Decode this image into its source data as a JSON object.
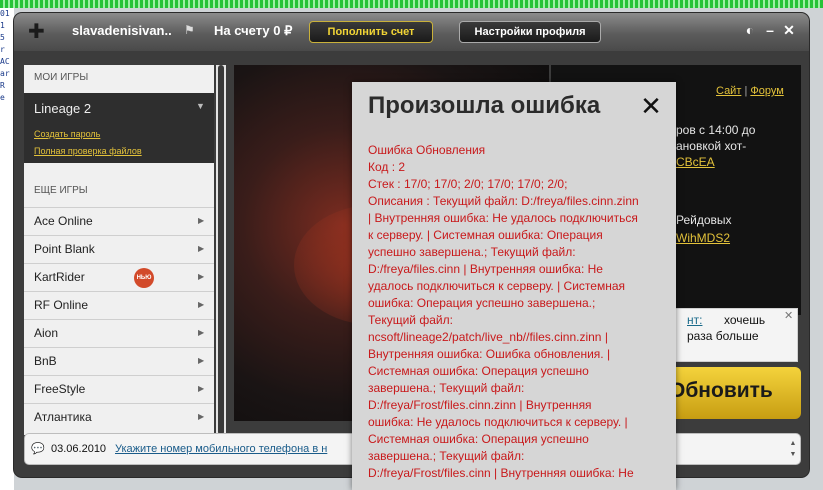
{
  "window": {
    "username": "slavadenisivan..",
    "balance": "На счету 0 ₽",
    "topup_label": "Пополнить счет",
    "profile_label": "Настройки профиля"
  },
  "background_window": {
    "lines": [
      "01",
      "1",
      "5",
      "r",
      "AC",
      "ar",
      "R",
      "e"
    ]
  },
  "sidebar": {
    "my_games_header": "МОИ ИГРЫ",
    "active_game": {
      "name": "Lineage 2",
      "link_password": "Создать пароль",
      "link_check": "Полная проверка файлов"
    },
    "more_games_header": "ЕЩЕ ИГРЫ",
    "games": [
      {
        "name": "Ace Online"
      },
      {
        "name": "Point Blank"
      },
      {
        "name": "KartRider",
        "badge": "НЬЮ"
      },
      {
        "name": "RF Online"
      },
      {
        "name": "Aion"
      },
      {
        "name": "BnB"
      },
      {
        "name": "FreeStyle"
      },
      {
        "name": "Атлантика"
      }
    ]
  },
  "news": {
    "link_site": "Сайт",
    "separator": "|",
    "link_forum": "Форум",
    "line1": "ров с 14:00 до",
    "line2": "ановкой хот-",
    "link1": "CBcEA",
    "line3": "Рейдовых",
    "link2": "WihMDS2"
  },
  "tip": {
    "link": "нт:",
    "text1": "хочешь",
    "text2": "раза больше"
  },
  "update_button": {
    "label": "Обновить"
  },
  "status": {
    "date": "03.06.2010",
    "message": "Укажите номер мобильного телефона в н"
  },
  "dialog": {
    "title": "Произошла ошибка",
    "lines": [
      "Ошибка Обновления",
      "Код : 2",
      "Стек : 17/0; 17/0; 2/0; 17/0; 17/0; 2/0;",
      "Описания : Текущий файл: D:/freya/files.cinn.zinn",
      "| Внутренняя ошибка: Не удалось подключиться",
      "к серверу. | Системная ошибка: Операция",
      "успешно завершена.; Текущий файл:",
      "D:/freya/files.cinn | Внутренняя ошибка: Не",
      "удалось подключиться к серверу. | Системная",
      "ошибка: Операция успешно завершена.;",
      "Текущий файл:",
      "ncsoft/lineage2/patch/live_nb//files.cinn.zinn |",
      "Внутренняя ошибка: Ошибка обновления. |",
      "Системная ошибка: Операция успешно",
      "завершена.; Текущий файл:",
      "D:/freya/Frost/files.cinn.zinn | Внутренняя",
      "ошибка: Не удалось подключиться к серверу. |",
      "Системная ошибка: Операция успешно",
      "завершена.; Текущий файл:",
      "D:/freya/Frost/files.cinn | Внутренняя ошибка: Не"
    ]
  }
}
